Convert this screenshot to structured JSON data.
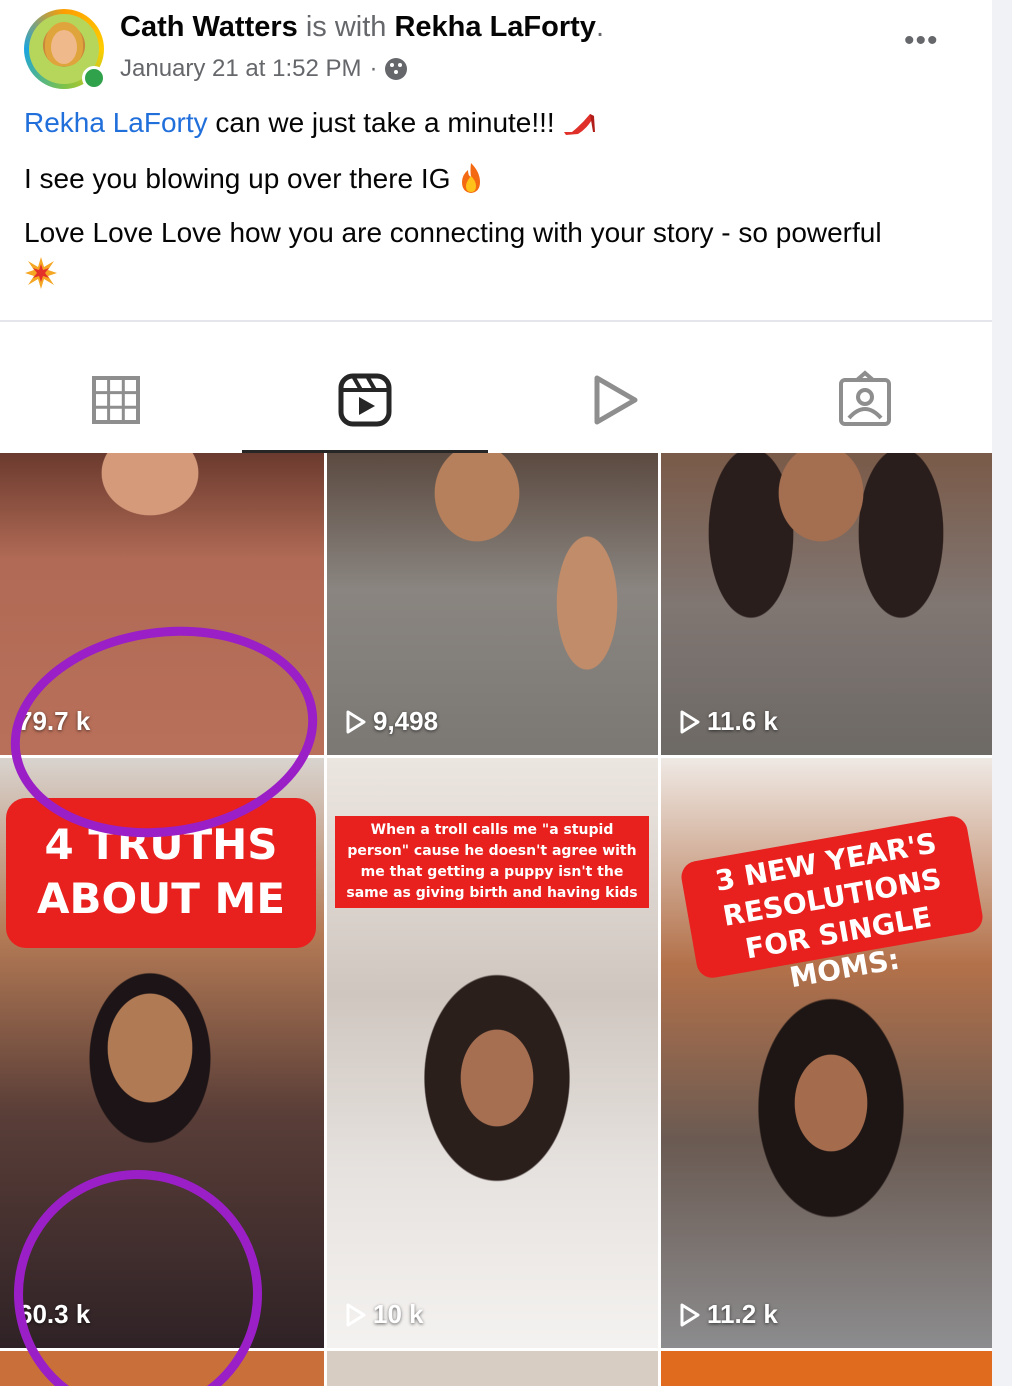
{
  "post": {
    "author": "Cath Watters",
    "with_word": "is with",
    "tagged": "Rekha LaForty",
    "period": ".",
    "timestamp": "January 21 at 1:52 PM",
    "separator": "·",
    "privacy_icon": "friends-icon",
    "more_label": "•••",
    "line1_mention": "Rekha LaForty",
    "line1_text": " can we just take a minute!!! ",
    "line2_text": "I see you blowing up over there IG ",
    "line3_text": "Love Love Love how you are connecting with your story - so powerful "
  },
  "instagram": {
    "tabs": [
      {
        "icon": "grid-icon"
      },
      {
        "icon": "reels-icon",
        "active": true
      },
      {
        "icon": "play-icon"
      },
      {
        "icon": "tagged-icon"
      }
    ],
    "tiles": [
      {
        "count": "79.7 k",
        "bg": "#b06a55",
        "play": false
      },
      {
        "count": "9,498",
        "bg": "#8d8a86",
        "play": true
      },
      {
        "count": "11.6 k",
        "bg": "#7b6a60",
        "play": true
      },
      {
        "count": "60.3 k",
        "bg": "#4b3a3a",
        "play": false,
        "caption": "4 TRUTHS ABOUT ME"
      },
      {
        "count": "10 k",
        "bg": "#b7aaa2",
        "play": true,
        "caption": "When a troll calls me \"a stupid person\" cause he doesn't agree with me that getting a puppy isn't the same as giving birth and having kids"
      },
      {
        "count": "11.2 k",
        "bg": "#6e5f58",
        "play": true,
        "caption": "3 NEW YEAR'S RESOLUTIONS FOR SINGLE MOMS:"
      }
    ]
  },
  "colors": {
    "mention": "#216fdb",
    "circle": "#9a1fc7",
    "caption_red": "#e8201e",
    "online": "#31a24c"
  }
}
